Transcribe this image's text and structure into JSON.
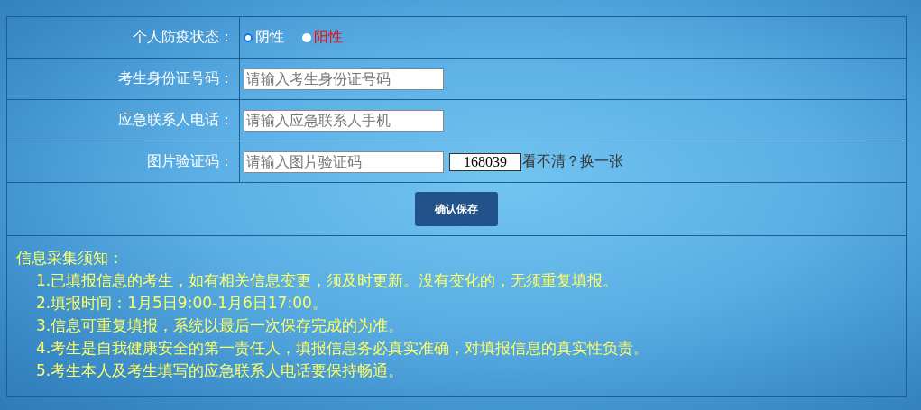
{
  "form": {
    "rows": [
      {
        "kind": "radio",
        "label": "个人防疫状态：",
        "options": [
          {
            "label": "阴性",
            "selected": true,
            "color": "#ffffff"
          },
          {
            "label": "阳性",
            "selected": false,
            "color": "#ff0000"
          }
        ]
      },
      {
        "kind": "text",
        "label": "考生身份证号码：",
        "placeholder": "请输入考生身份证号码"
      },
      {
        "kind": "text",
        "label": "应急联系人电话：",
        "placeholder": "请输入应急联系人手机"
      },
      {
        "kind": "captcha",
        "label": "图片验证码：",
        "placeholder": "请输入图片验证码",
        "captcha": "168039",
        "refresh_link": "看不清？换一张"
      }
    ],
    "submit_button": "确认保存"
  },
  "notice": {
    "title": "信息采集须知：",
    "items": [
      "1.已填报信息的考生，如有相关信息变更，须及时更新。没有变化的，无须重复填报。",
      "2.填报时间：1月5日9:00-1月6日17:00。",
      "3.信息可重复填报，系统以最后一次保存完成的为准。",
      "4.考生是自我健康安全的第一责任人，填报信息务必真实准确，对填报信息的真实性负责。",
      "5.考生本人及考生填写的应急联系人电话要保持畅通。"
    ]
  }
}
